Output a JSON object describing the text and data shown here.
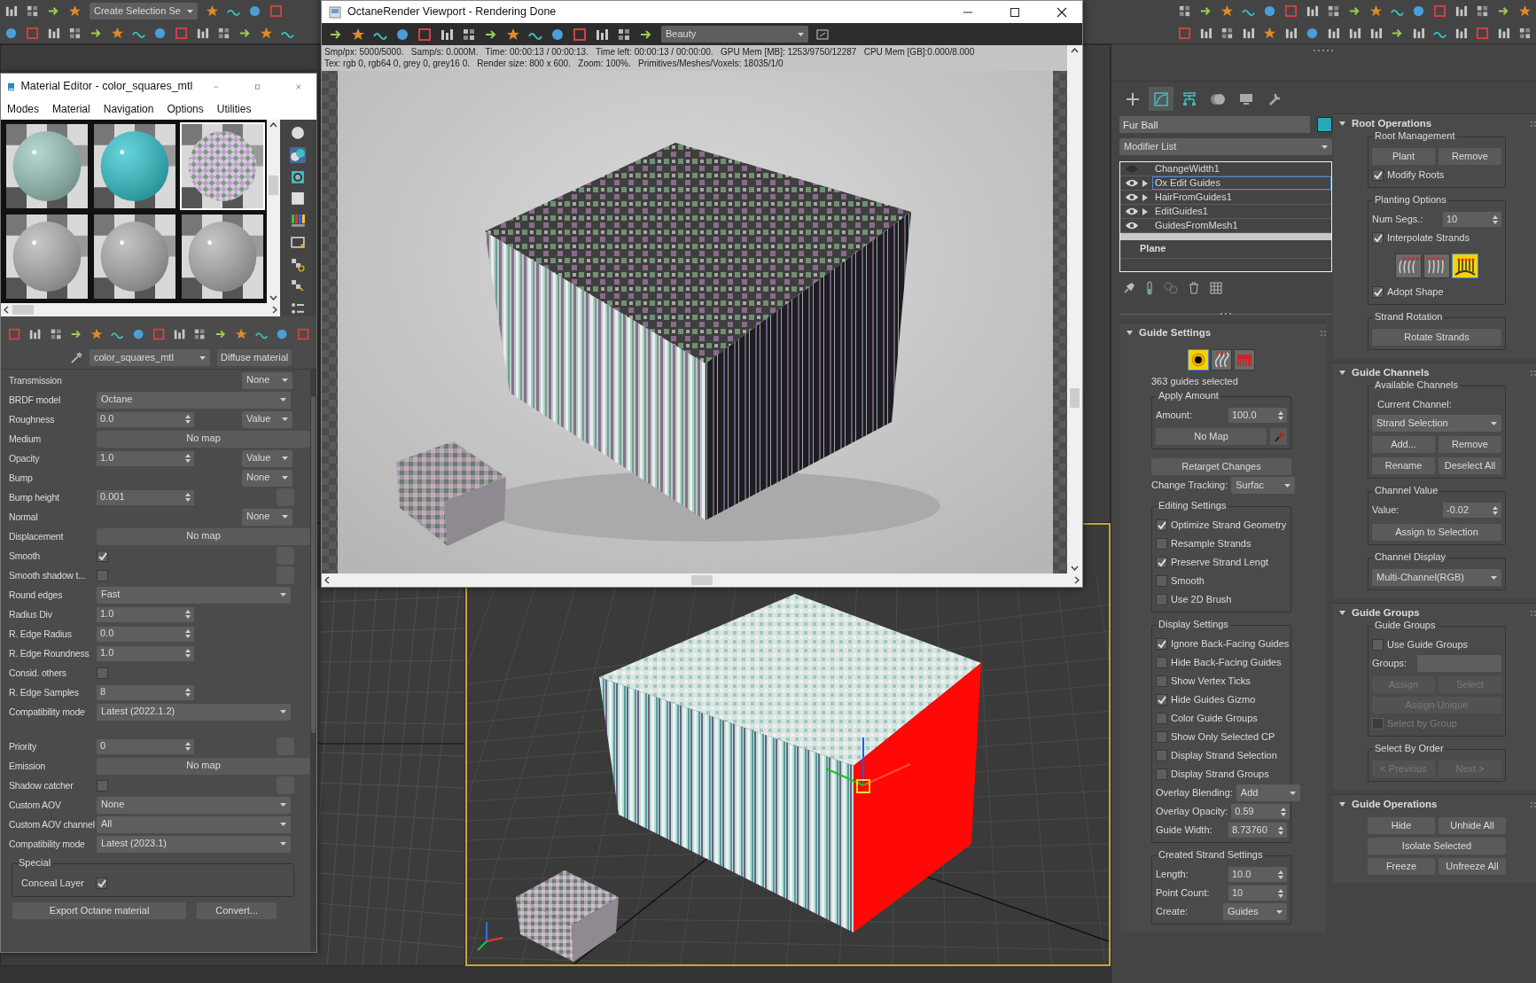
{
  "main_toolbar": {
    "selection_set": "Create Selection Se"
  },
  "material_editor": {
    "title": "Material Editor - color_squares_mtl",
    "menu": [
      "Modes",
      "Material",
      "Navigation",
      "Options",
      "Utilities"
    ],
    "sample_slots": [
      {
        "kind": "picture",
        "selected": false
      },
      {
        "kind": "picture",
        "selected": false
      },
      {
        "kind": "picture",
        "selected": true
      },
      {
        "kind": "picture",
        "selected": false
      },
      {
        "kind": "picture",
        "selected": false
      },
      {
        "kind": "picture",
        "selected": false
      }
    ],
    "material_name": "color_squares_mtl",
    "material_type": "Diffuse material",
    "params": [
      {
        "label": "Transmission",
        "kind": "empty",
        "side": "None"
      },
      {
        "label": "BRDF model",
        "kind": "dropdown",
        "value": "Octane"
      },
      {
        "label": "Roughness",
        "kind": "spinner",
        "value": "0.0",
        "side": "Value"
      },
      {
        "label": "Medium",
        "kind": "map",
        "value": "No map"
      },
      {
        "label": "Opacity",
        "kind": "spinner",
        "value": "1.0",
        "side": "Value"
      },
      {
        "label": "Bump",
        "kind": "empty",
        "side": "None"
      },
      {
        "label": "Bump height",
        "kind": "spinner",
        "value": "0.001",
        "map_slot": true
      },
      {
        "label": "Normal",
        "kind": "empty",
        "side": "None"
      },
      {
        "label": "Displacement",
        "kind": "map",
        "value": "No map"
      },
      {
        "label": "Smooth",
        "kind": "checkbox",
        "checked": true,
        "map_slot": true
      },
      {
        "label": "Smooth shadow t...",
        "kind": "checkbox",
        "checked": false,
        "map_slot": true
      },
      {
        "label": "Round edges",
        "kind": "dropdown",
        "value": "Fast"
      },
      {
        "label": "Radius Div",
        "kind": "spinner",
        "value": "1.0"
      },
      {
        "label": "R. Edge Radius",
        "kind": "spinner",
        "value": "0.0"
      },
      {
        "label": "R. Edge Roundness",
        "kind": "spinner",
        "value": "1.0"
      },
      {
        "label": "Consid. others",
        "kind": "checkbox",
        "checked": false
      },
      {
        "label": "R. Edge Samples",
        "kind": "spinner",
        "value": "8"
      },
      {
        "label": "Compatibility mode",
        "kind": "dropdown",
        "value": "Latest (2022.1.2)"
      },
      {
        "kind": "gap"
      },
      {
        "label": "Priority",
        "kind": "spinner",
        "value": "0",
        "map_slot": true
      },
      {
        "label": "Emission",
        "kind": "map",
        "value": "No map"
      },
      {
        "label": "Shadow catcher",
        "kind": "checkbox",
        "checked": false,
        "map_slot": true
      },
      {
        "label": "Custom AOV",
        "kind": "dropdown",
        "value": "None"
      },
      {
        "label": "Custom AOV channel",
        "kind": "dropdown",
        "value": "All"
      },
      {
        "label": "Compatibility mode",
        "kind": "dropdown",
        "value": "Latest (2023.1)"
      }
    ],
    "special": {
      "title": "Special",
      "label": "Conceal Layer",
      "checked": true
    },
    "buttons": [
      "Export Octane material",
      "Convert..."
    ]
  },
  "octane": {
    "title": "OctaneRender Viewport - Rendering Done",
    "pass": "Beauty",
    "status": [
      "Smp/px: 5000/5000.   Samp/s: 0.000M.   Time: 00:00:13 / 00:00:13.   Time left: 00:00:13 / 00:00:00.   GPU Mem [MB]: 1253/9750/12287   CPU Mem [GB]:0.000/8.000",
      "Tex: rgb 0, rgb64 0, grey 0, grey16 0.   Render size: 800 x 600.   Zoom: 100%.   Primitives/Meshes/Voxels: 18035/1/0"
    ],
    "render": {
      "kind": "picture"
    }
  },
  "command_panel": {
    "tabs": [
      {
        "selected": false
      },
      {
        "selected": true
      },
      {
        "selected": false
      },
      {
        "selected": false
      },
      {
        "selected": false
      },
      {
        "selected": false
      }
    ],
    "object_name": "Fur Ball",
    "modifier_list": "Modifier List",
    "stack": [
      {
        "label": "ChangeWidth1",
        "enabled": false,
        "expandable": false,
        "selected": false
      },
      {
        "label": "Ox Edit Guides",
        "enabled": true,
        "expandable": true,
        "selected": true
      },
      {
        "label": "HairFromGuides1",
        "enabled": true,
        "expandable": true,
        "selected": false
      },
      {
        "label": "EditGuides1",
        "enabled": true,
        "expandable": true,
        "selected": false
      },
      {
        "label": "GuidesFromMesh1",
        "enabled": true,
        "expandable": false,
        "selected": false
      }
    ],
    "base_object": "Plane",
    "guide_settings": {
      "title": "Guide Settings",
      "modes": [
        {
          "selected": true
        },
        {
          "selected": false
        },
        {
          "selected": false
        }
      ],
      "selection_info": "363 guides selected",
      "apply_amount": {
        "title": "Apply Amount",
        "label": "Amount:",
        "value": "100.0",
        "map": "No Map"
      },
      "retarget": "Retarget Changes",
      "change_tracking": {
        "label": "Change Tracking:",
        "value": "Surfac"
      },
      "editing": {
        "title": "Editing Settings",
        "options": [
          {
            "label": "Optimize Strand Geometry",
            "checked": true
          },
          {
            "label": "Resample Strands",
            "checked": false
          },
          {
            "label": "Preserve Strand Lengt",
            "checked": true
          },
          {
            "label": "Smooth",
            "checked": false
          },
          {
            "label": "Use 2D Brush",
            "checked": false
          }
        ]
      },
      "display": {
        "title": "Display Settings",
        "options": [
          {
            "label": "Ignore Back-Facing Guides",
            "checked": true
          },
          {
            "label": "Hide Back-Facing Guides",
            "checked": false
          },
          {
            "label": "Show Vertex Ticks",
            "checked": false
          },
          {
            "label": "Hide Guides Gizmo",
            "checked": true
          },
          {
            "label": "Color Guide Groups",
            "checked": false
          },
          {
            "label": "Show Only Selected CP",
            "checked": false
          },
          {
            "label": "Display Strand Selection",
            "checked": false
          },
          {
            "label": "Display Strand Groups",
            "checked": false
          }
        ],
        "fields": [
          {
            "label": "Overlay Blending:",
            "kind": "dropdown",
            "value": "Add"
          },
          {
            "label": "Overlay Opacity:",
            "kind": "spinner",
            "value": "0.59"
          },
          {
            "label": "Guide Width:",
            "kind": "spinner",
            "value": "8.73760"
          }
        ]
      },
      "created": {
        "title": "Created Strand Settings",
        "fields": [
          {
            "label": "Length:",
            "kind": "spinner",
            "value": "10.0"
          },
          {
            "label": "Point Count:",
            "kind": "spinner",
            "value": "10"
          },
          {
            "label": "Create:",
            "kind": "dropdown",
            "value": "Guides"
          }
        ]
      }
    },
    "root_operations": {
      "title": "Root Operations",
      "root_management": {
        "title": "Root Management",
        "buttons": [
          "Plant",
          "Remove"
        ],
        "modify_roots": {
          "label": "Modify Roots",
          "checked": true
        }
      },
      "planting": {
        "title": "Planting Options",
        "num_segs": {
          "label": "Num Segs.:",
          "value": "10"
        },
        "interpolate": {
          "label": "Interpolate Strands",
          "checked": true
        },
        "modes": [
          {
            "selected": false
          },
          {
            "selected": false
          },
          {
            "selected": true
          }
        ],
        "adopt": {
          "label": "Adopt Shape",
          "checked": true
        }
      },
      "rotation": {
        "title": "Strand Rotation",
        "button": "Rotate Strands"
      }
    },
    "guide_channels": {
      "title": "Guide Channels",
      "available": {
        "title": "Available Channels",
        "label": "Current Channel:",
        "value": "Strand Selection",
        "buttons": [
          "Add...",
          "Remove",
          "Rename",
          "Deselect All"
        ]
      },
      "channel_value": {
        "title": "Channel Value",
        "label": "Value:",
        "value": "-0.02",
        "button": "Assign to Selection"
      },
      "display": {
        "title": "Channel Display",
        "value": "Multi-Channel(RGB)"
      }
    },
    "guide_groups": {
      "title": "Guide Groups",
      "group_title": "Guide Groups",
      "use": {
        "label": "Use Guide Groups",
        "checked": false
      },
      "groups_label": "Groups:",
      "buttons": [
        {
          "label": "Assign",
          "disabled": true
        },
        {
          "label": "Select",
          "disabled": true
        },
        {
          "label": "Assign Unique",
          "disabled": true
        }
      ],
      "select_by_group": {
        "label": "Select by Group",
        "checked": false,
        "disabled": true
      },
      "order": {
        "title": "Select By Order",
        "buttons": [
          {
            "label": "< Previous",
            "disabled": true
          },
          {
            "label": "Next >",
            "disabled": true
          }
        ]
      }
    },
    "guide_operations": {
      "title": "Guide Operations",
      "buttons": [
        "Hide",
        "Unhide All",
        "Isolate Selected",
        "Freeze",
        "Unfreeze All"
      ]
    }
  }
}
